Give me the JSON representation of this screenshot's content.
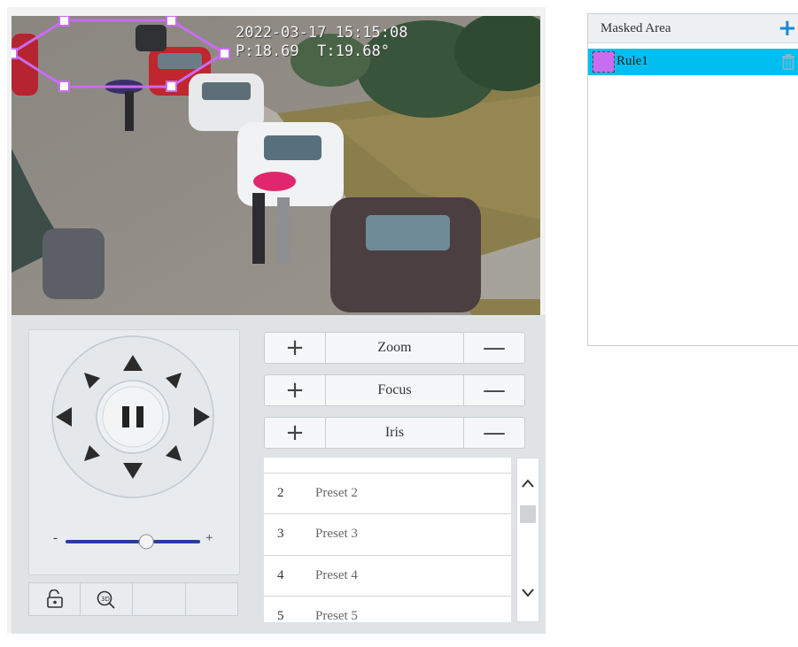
{
  "video": {
    "osd_line1": "2022-03-17 15:15:08",
    "osd_line2": "P:18.69  T:19.68°",
    "mask_color": "#c86cf2"
  },
  "ptz": {
    "speed_min_label": "-",
    "speed_max_label": "+",
    "speed_level": 0.6,
    "icons": [
      "arrow-up-icon",
      "arrow-up-right-icon",
      "arrow-right-icon",
      "arrow-down-right-icon",
      "arrow-down-icon",
      "arrow-down-left-icon",
      "arrow-left-icon",
      "arrow-up-left-icon",
      "pause-icon"
    ],
    "toolbar_icons": [
      "lock-icon",
      "3d-zoom-icon"
    ],
    "toolbar_3d_label": "3D"
  },
  "lens": {
    "zoom_label": "Zoom",
    "focus_label": "Focus",
    "iris_label": "Iris",
    "plus_symbol": "+",
    "minus_symbol": "—"
  },
  "presets": [
    {
      "num": "2",
      "name": "Preset 2"
    },
    {
      "num": "3",
      "name": "Preset 3"
    },
    {
      "num": "4",
      "name": "Preset 4"
    },
    {
      "num": "5",
      "name": "Preset 5"
    }
  ],
  "masked_area": {
    "header": "Masked Area",
    "add_symbol": "+",
    "accent": "#1a88d8",
    "selected_color": "#00bff0",
    "rules": [
      {
        "name": "Rule1",
        "color": "#c86cf2"
      }
    ]
  }
}
